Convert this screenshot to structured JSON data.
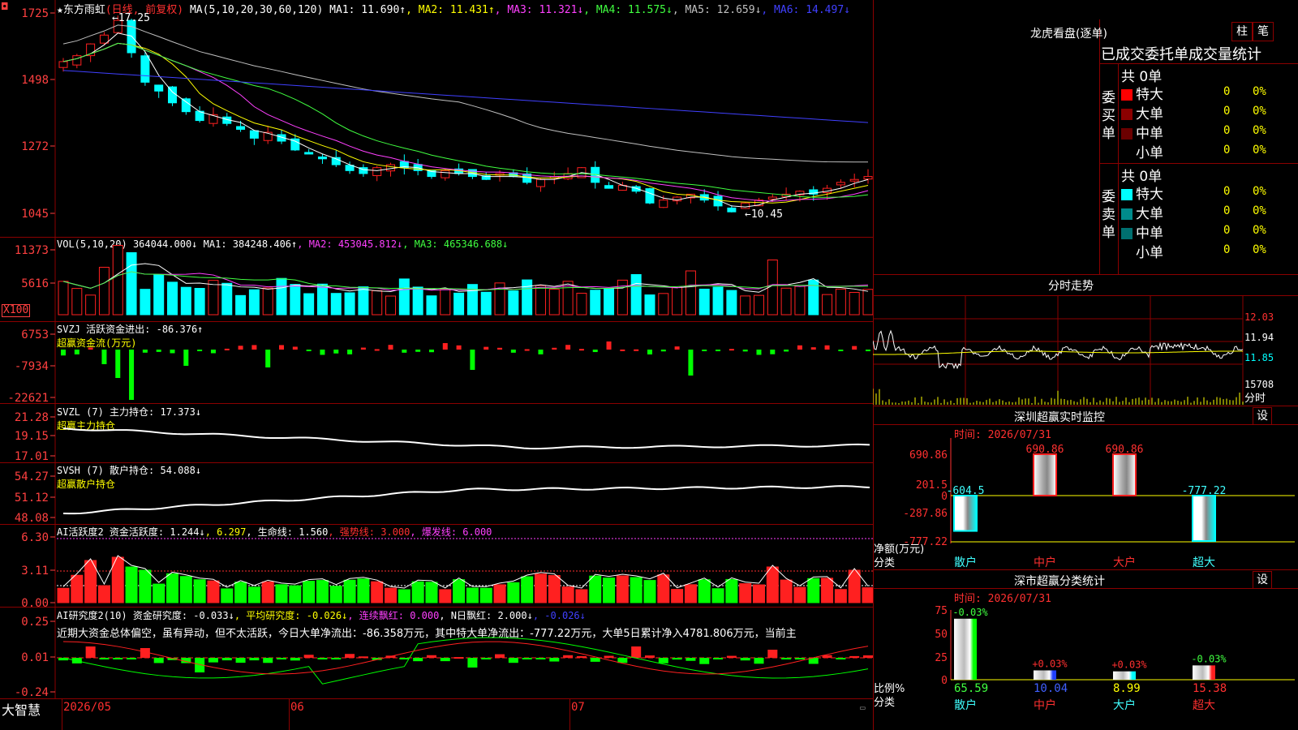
{
  "main": {
    "title": "★东方雨虹",
    "period": "(日线, 前复权)",
    "ma_params": "MA(5,10,20,30,60,120)",
    "ma": [
      {
        "label": "MA1: 11.690↑",
        "color": "#ffffff"
      },
      {
        "label": "MA2: 11.431↑",
        "color": "#ffff00"
      },
      {
        "label": "MA3: 11.321↓",
        "color": "#ff40ff"
      },
      {
        "label": "MA4: 11.575↓",
        "color": "#40ff40"
      },
      {
        "label": "MA5: 12.659↓",
        "color": "#c0c0c0"
      },
      {
        "label": "MA6: 14.497↓",
        "color": "#4040ff"
      }
    ],
    "yticks": [
      "1725",
      "1498",
      "1272",
      "1045"
    ],
    "high_label": "17.25",
    "low_label": "10.45",
    "top_marker": "◘"
  },
  "vol": {
    "title": "VOL(5,10,20)",
    "value": "364044.000↓",
    "ma": [
      {
        "label": "MA1: 384248.406↑",
        "color": "#ffffff"
      },
      {
        "label": "MA2: 453045.812↓",
        "color": "#ff40ff"
      },
      {
        "label": "MA3: 465346.688↓",
        "color": "#40ff40"
      }
    ],
    "yticks": [
      "11373",
      "5616"
    ],
    "unit": "X100"
  },
  "svzj": {
    "title": "SVZJ",
    "label": "活跃资金进出: -86.376↑",
    "subtitle": "超赢资金流(万元)",
    "yticks": [
      "6753",
      "-7934",
      "-22621"
    ]
  },
  "svzl": {
    "title": "SVZL (7)",
    "label": "主力持仓: 17.373↓",
    "subtitle": "超赢主力持仓",
    "yticks": [
      "21.28",
      "19.15",
      "17.01"
    ]
  },
  "svsh": {
    "title": "SVSH (7)",
    "label": "散户持仓: 54.088↓",
    "subtitle": "超赢散户持仓",
    "yticks": [
      "54.27",
      "51.12",
      "48.08"
    ]
  },
  "ai1": {
    "title": "AI活跃度2",
    "items": [
      {
        "label": "资金活跃度: 1.244↓",
        "color": "#ffffff"
      },
      {
        "label": "6.297",
        "color": "#ffff00"
      },
      {
        "label": "生命线: 1.560",
        "color": "#ffffff"
      },
      {
        "label": "强势线: 3.000",
        "color": "#ff3030"
      },
      {
        "label": "爆发线: 6.000",
        "color": "#ff40ff"
      }
    ],
    "yticks": [
      "6.30",
      "3.11",
      "0.00"
    ]
  },
  "ai2": {
    "title": "AI研究度2(10)",
    "items": [
      {
        "label": "资金研究度: -0.033↓",
        "color": "#ffffff"
      },
      {
        "label": "平均研究度: -0.026↓",
        "color": "#ffff00"
      },
      {
        "label": "连续飘红: 0.000",
        "color": "#ff40ff"
      },
      {
        "label": "N日飘红: 2.000↓",
        "color": "#ffffff"
      },
      {
        "label": "-0.026↓",
        "color": "#4040ff"
      }
    ],
    "comment": "近期大资金总体偏空，虽有异动，但不太活跃，今日大单净流出：-86.358万元，其中特大单净流出：-777.22万元，大单5日累计净入4781.806万元，当前主",
    "yticks": [
      "0.25",
      "0.01",
      "-0.24"
    ]
  },
  "footer": {
    "brand": "大智慧",
    "dates": [
      "2026/05",
      "06",
      "07"
    ]
  },
  "dragon": {
    "title": "龙虎看盘(逐单)",
    "btn1": "柱",
    "btn2": "笔",
    "subtitle": "已成交委托单成交量统计",
    "buy_label": "委买单",
    "sell_label": "委卖单",
    "buy_total": "共 0单",
    "sell_total": "共 0单",
    "buy_rows": [
      {
        "name": "特大",
        "count": "0",
        "pct": "0%",
        "color": "#ff0000"
      },
      {
        "name": "大单",
        "count": "0",
        "pct": "0%",
        "color": "#8b0000"
      },
      {
        "name": "中单",
        "count": "0",
        "pct": "0%",
        "color": "#6b0000"
      },
      {
        "name": "小单",
        "count": "0",
        "pct": "0%",
        "color": ""
      }
    ],
    "sell_rows": [
      {
        "name": "特大",
        "count": "0",
        "pct": "0%",
        "color": "#00ffff"
      },
      {
        "name": "大单",
        "count": "0",
        "pct": "0%",
        "color": "#008b8b"
      },
      {
        "name": "中单",
        "count": "0",
        "pct": "0%",
        "color": "#007070"
      },
      {
        "name": "小单",
        "count": "0",
        "pct": "0%",
        "color": ""
      }
    ]
  },
  "intraday": {
    "title": "分时走势",
    "yticks": [
      "12.03",
      "11.94",
      "11.85"
    ],
    "vol_label": "15708",
    "time_label": "分时"
  },
  "monitor": {
    "title": "深圳超赢实时监控",
    "btn": "设",
    "time": "时间: 2026/07/31",
    "yticks": [
      "690.86",
      "201.5",
      "0",
      "-287.86",
      "-777.22"
    ],
    "ylabel": "净额(万元)",
    "xlabel": "分类",
    "categories": [
      "散户",
      "中户",
      "大户",
      "超大"
    ],
    "values": [
      -604.5,
      690.86,
      690.86,
      -777.22
    ],
    "value_labels": [
      "-604.5",
      "690.86",
      "690.86",
      "-777.22"
    ]
  },
  "classify": {
    "title": "深市超赢分类统计",
    "btn": "设",
    "time": "时间: 2026/07/31",
    "yticks": [
      "75",
      "50",
      "25",
      "0"
    ],
    "ylabel": "比例%",
    "xlabel": "分类",
    "categories": [
      "散户",
      "中户",
      "大户",
      "超大"
    ],
    "values": [
      65.59,
      10.04,
      8.99,
      15.38
    ],
    "value_labels": [
      "65.59",
      "10.04",
      "8.99",
      "15.38"
    ],
    "changes": [
      "-0.03%",
      "+0.03%",
      "+0.03%",
      "-0.03%"
    ]
  },
  "colors": {
    "up": "#ff0000",
    "down": "#00ffff",
    "grid": "#8b0000",
    "ma1": "#ffffff",
    "ma2": "#ffff00",
    "ma3": "#ff40ff",
    "ma4": "#40ff40",
    "ma5": "#c0c0c0",
    "ma6": "#4040ff"
  }
}
